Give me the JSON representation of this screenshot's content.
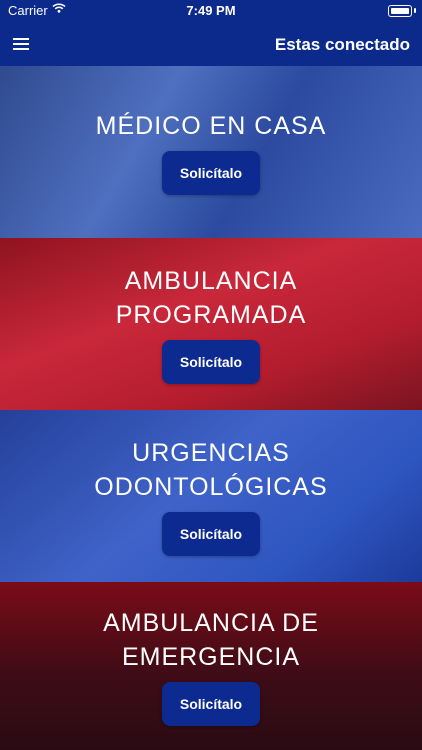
{
  "status": {
    "carrier": "Carrier",
    "time": "7:49 PM"
  },
  "header": {
    "title": "Estas conectado"
  },
  "cards": [
    {
      "title": "MÉDICO EN CASA",
      "button": "Solicítalo"
    },
    {
      "title": "AMBULANCIA PROGRAMADA",
      "button": "Solicítalo"
    },
    {
      "title": "URGENCIAS ODONTOLÓGICAS",
      "button": "Solicítalo"
    },
    {
      "title": "AMBULANCIA DE EMERGENCIA",
      "button": "Solicítalo"
    }
  ],
  "icons": [
    "wifi-icon",
    "battery-icon",
    "menu-icon"
  ],
  "colors": {
    "primary": "#0b2a8c",
    "red": "#c8283a"
  }
}
